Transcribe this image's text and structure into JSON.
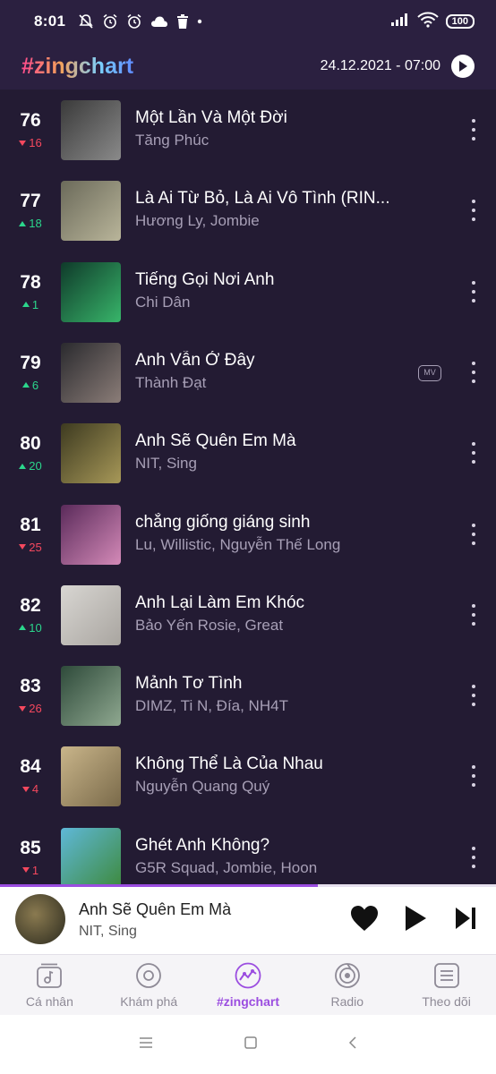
{
  "status_bar": {
    "time": "8:01",
    "battery": "100"
  },
  "header": {
    "brand": "#zingchart",
    "date": "24.12.2021 - 07:00"
  },
  "songs": [
    {
      "rank": "76",
      "change": "16",
      "direction": "down",
      "title": "Một Lần Và Một Đời",
      "artist": "Tăng Phúc",
      "mv": false,
      "cover_colors": [
        "#3a3a3a",
        "#8a8a8a"
      ]
    },
    {
      "rank": "77",
      "change": "18",
      "direction": "up",
      "title": "Là Ai Từ Bỏ, Là Ai Vô Tình (RIN...",
      "artist": "Hương Ly, Jombie",
      "mv": false,
      "cover_colors": [
        "#6b6a5a",
        "#b9b59a"
      ]
    },
    {
      "rank": "78",
      "change": "1",
      "direction": "up",
      "title": "Tiếng Gọi Nơi Anh",
      "artist": "Chi Dân",
      "mv": false,
      "cover_colors": [
        "#0f3a2a",
        "#38b56a"
      ]
    },
    {
      "rank": "79",
      "change": "6",
      "direction": "up",
      "title": "Anh Vẫn Ở Đây",
      "artist": "Thành Đạt",
      "mv": true,
      "mv_label": "MV",
      "cover_colors": [
        "#2a2a2e",
        "#8b7d78"
      ]
    },
    {
      "rank": "80",
      "change": "20",
      "direction": "up",
      "title": "Anh Sẽ Quên Em Mà",
      "artist": "NIT, Sing",
      "mv": false,
      "cover_colors": [
        "#3d3a20",
        "#a79858"
      ]
    },
    {
      "rank": "81",
      "change": "25",
      "direction": "down",
      "title": "chẳng giống giáng sinh",
      "artist": "Lu, Willistic, Nguyễn Thế Long",
      "mv": false,
      "cover_colors": [
        "#5a2a5a",
        "#d48ab8"
      ]
    },
    {
      "rank": "82",
      "change": "10",
      "direction": "up",
      "title": "Anh Lại Làm Em Khóc",
      "artist": "Bảo Yến Rosie, Great",
      "mv": false,
      "cover_colors": [
        "#d8d6d2",
        "#a9a5a0"
      ]
    },
    {
      "rank": "83",
      "change": "26",
      "direction": "down",
      "title": "Mảnh Tơ Tình",
      "artist": "DIMZ, Ti N, Đía, NH4T",
      "mv": false,
      "cover_colors": [
        "#2e4a3a",
        "#8fa890"
      ]
    },
    {
      "rank": "84",
      "change": "4",
      "direction": "down",
      "title": "Không Thể Là Của Nhau",
      "artist": "Nguyễn Quang Quý",
      "mv": false,
      "cover_colors": [
        "#c9b58a",
        "#7a6a4a"
      ]
    },
    {
      "rank": "85",
      "change": "1",
      "direction": "down",
      "title": "Ghét Anh Không?",
      "artist": "G5R Squad, Jombie, Hoon",
      "mv": false,
      "cover_colors": [
        "#5fb8d8",
        "#3e8a3e"
      ]
    }
  ],
  "player": {
    "title": "Anh Sẽ Quên Em Mà",
    "artist": "NIT, Sing",
    "progress": 0.64,
    "cover_colors": [
      "#2b2a1e",
      "#8a7a50"
    ]
  },
  "bottom_nav": [
    {
      "label": "Cá nhân",
      "icon": "music-library-icon",
      "active": false
    },
    {
      "label": "Khám phá",
      "icon": "disc-icon",
      "active": false
    },
    {
      "label": "#zingchart",
      "icon": "chart-icon",
      "active": true
    },
    {
      "label": "Radio",
      "icon": "radio-icon",
      "active": false
    },
    {
      "label": "Theo dõi",
      "icon": "feed-icon",
      "active": false
    }
  ],
  "colors": {
    "background": "#231b33",
    "accent": "#9b4de0",
    "up": "#2bd68c",
    "down": "#f5485e"
  }
}
